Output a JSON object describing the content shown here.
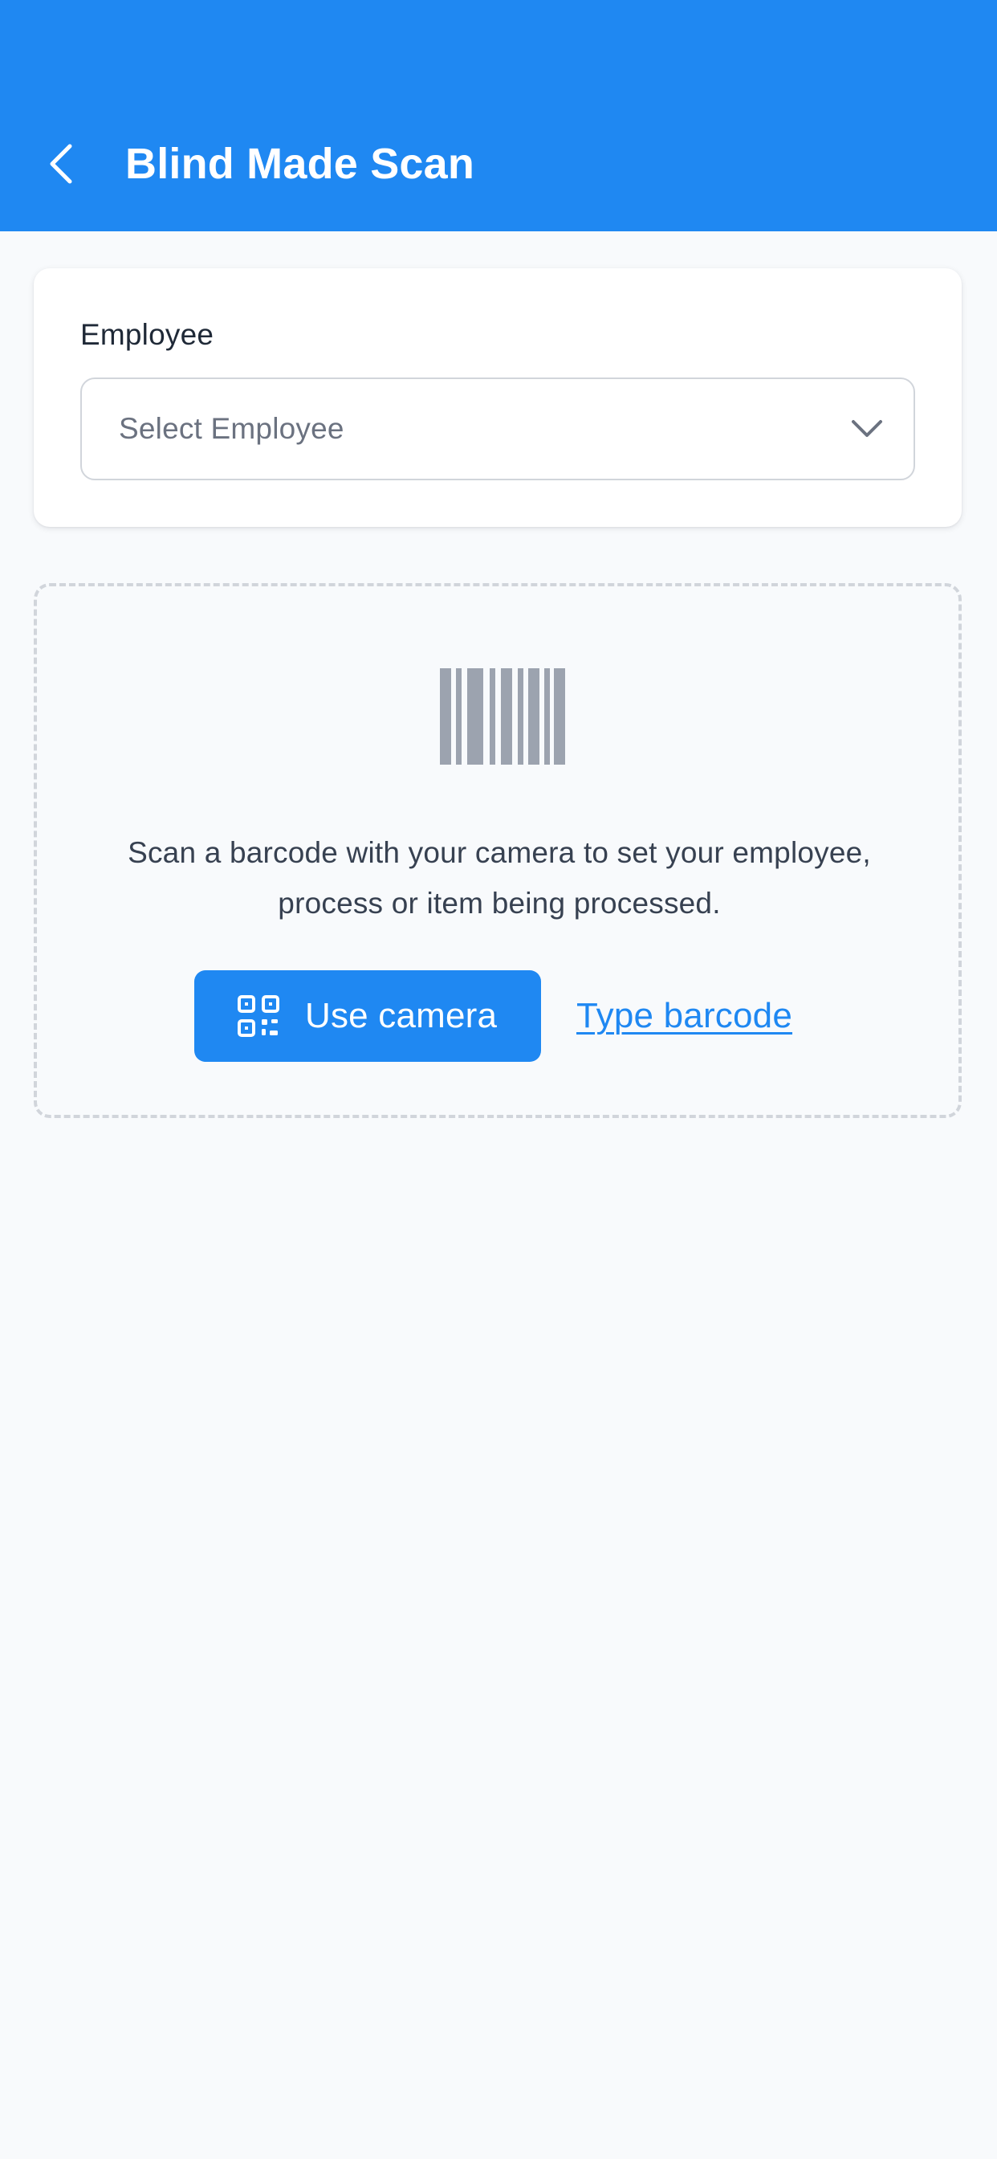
{
  "header": {
    "title": "Blind Made Scan",
    "back_icon": "chevron-left-icon",
    "background_color": "#1f88f2"
  },
  "employee_card": {
    "label": "Employee",
    "select": {
      "placeholder": "Select Employee",
      "icon": "chevron-down-icon"
    }
  },
  "scan_zone": {
    "icon": "barcode-icon",
    "instructions": "Scan a barcode with your camera to set your employee, process or item being processed.",
    "camera_button": {
      "label": "Use camera",
      "icon": "qr-code-icon"
    },
    "type_link": {
      "label": "Type barcode"
    }
  },
  "colors": {
    "accent": "#1f88f2",
    "background": "#f8fafc",
    "icon_gray": "#9ca3af"
  }
}
